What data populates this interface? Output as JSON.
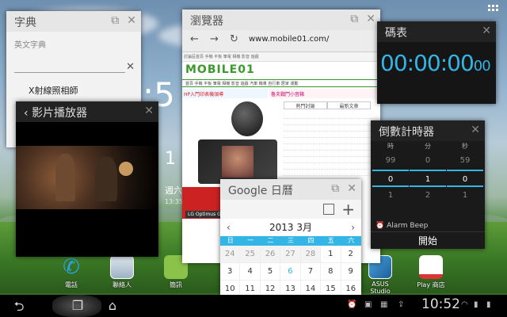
{
  "home": {
    "clock_partial": ":5",
    "clock_small": "1",
    "date_partial": "週六",
    "date_sub": "13:35"
  },
  "dictionary": {
    "title": "字典",
    "subtitle": "英文字典",
    "result_word": "X射線照相師"
  },
  "video": {
    "title": "影片播放器"
  },
  "browser": {
    "title": "瀏覽器",
    "url": "www.mobile01.com/",
    "logo": "MOBILE01",
    "banner_left": "HP入門印表機領導",
    "banner_right": "魯夫戰鬥小音箱",
    "caption": "LG Optimus G",
    "tab_a": "熱門討論",
    "tab_b": "最新文章",
    "menu_strip": "討論區首頁  手機  平板  筆電  相機  影音  遊戲",
    "nav_row": "首頁  手機  平板  筆電  相機  影音  遊戲  汽車  機車  自行車  居家  運動"
  },
  "stopwatch": {
    "title": "碼表",
    "time_main": "00:00:00",
    "time_ms": "00"
  },
  "countdown": {
    "title": "倒數計時器",
    "headers": [
      "時",
      "分",
      "秒"
    ],
    "hours": [
      "99",
      "0",
      "1"
    ],
    "minutes": [
      "0",
      "1",
      "2"
    ],
    "seconds": [
      "59",
      "0",
      "1"
    ],
    "alarm_label": "Alarm Beep",
    "start_label": "開始"
  },
  "calendar": {
    "title": "Google 日曆",
    "month": "2013  3月",
    "days_of_week": [
      "日",
      "一",
      "二",
      "三",
      "四",
      "五",
      "六"
    ],
    "week1": [
      "24",
      "25",
      "26",
      "27",
      "28",
      "1",
      "2"
    ],
    "week2": [
      "3",
      "4",
      "5",
      "6",
      "7",
      "8",
      "9"
    ],
    "week3": [
      "10",
      "11",
      "12",
      "13",
      "14",
      "15",
      "16"
    ]
  },
  "dock": {
    "phone": "電話",
    "contacts": "聯絡人",
    "messages": "簡訊",
    "studio": "ASUS Studio",
    "store": "Play 商店"
  },
  "statusbar": {
    "time": "10:52"
  }
}
